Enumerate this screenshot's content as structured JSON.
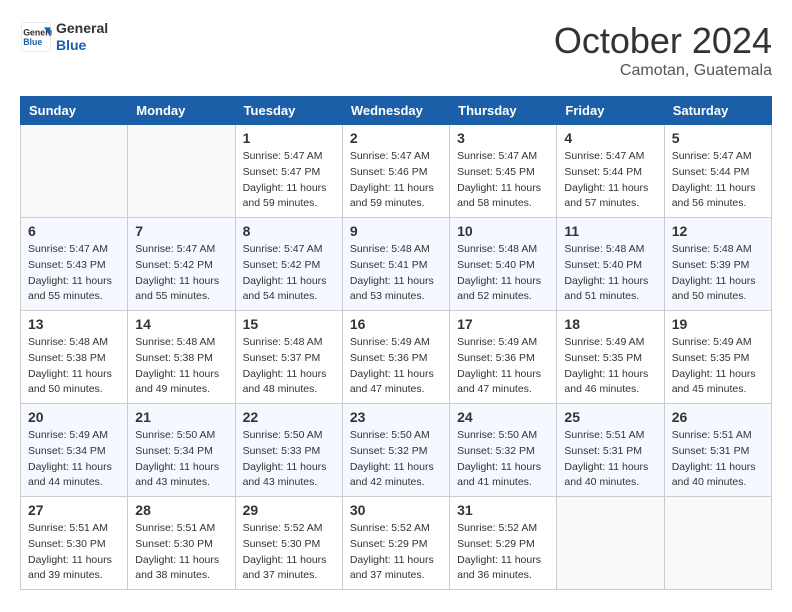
{
  "header": {
    "logo_line1": "General",
    "logo_line2": "Blue",
    "month": "October 2024",
    "location": "Camotan, Guatemala"
  },
  "weekdays": [
    "Sunday",
    "Monday",
    "Tuesday",
    "Wednesday",
    "Thursday",
    "Friday",
    "Saturday"
  ],
  "weeks": [
    [
      {
        "day": "",
        "sunrise": "",
        "sunset": "",
        "daylight": ""
      },
      {
        "day": "",
        "sunrise": "",
        "sunset": "",
        "daylight": ""
      },
      {
        "day": "1",
        "sunrise": "Sunrise: 5:47 AM",
        "sunset": "Sunset: 5:47 PM",
        "daylight": "Daylight: 11 hours and 59 minutes."
      },
      {
        "day": "2",
        "sunrise": "Sunrise: 5:47 AM",
        "sunset": "Sunset: 5:46 PM",
        "daylight": "Daylight: 11 hours and 59 minutes."
      },
      {
        "day": "3",
        "sunrise": "Sunrise: 5:47 AM",
        "sunset": "Sunset: 5:45 PM",
        "daylight": "Daylight: 11 hours and 58 minutes."
      },
      {
        "day": "4",
        "sunrise": "Sunrise: 5:47 AM",
        "sunset": "Sunset: 5:44 PM",
        "daylight": "Daylight: 11 hours and 57 minutes."
      },
      {
        "day": "5",
        "sunrise": "Sunrise: 5:47 AM",
        "sunset": "Sunset: 5:44 PM",
        "daylight": "Daylight: 11 hours and 56 minutes."
      }
    ],
    [
      {
        "day": "6",
        "sunrise": "Sunrise: 5:47 AM",
        "sunset": "Sunset: 5:43 PM",
        "daylight": "Daylight: 11 hours and 55 minutes."
      },
      {
        "day": "7",
        "sunrise": "Sunrise: 5:47 AM",
        "sunset": "Sunset: 5:42 PM",
        "daylight": "Daylight: 11 hours and 55 minutes."
      },
      {
        "day": "8",
        "sunrise": "Sunrise: 5:47 AM",
        "sunset": "Sunset: 5:42 PM",
        "daylight": "Daylight: 11 hours and 54 minutes."
      },
      {
        "day": "9",
        "sunrise": "Sunrise: 5:48 AM",
        "sunset": "Sunset: 5:41 PM",
        "daylight": "Daylight: 11 hours and 53 minutes."
      },
      {
        "day": "10",
        "sunrise": "Sunrise: 5:48 AM",
        "sunset": "Sunset: 5:40 PM",
        "daylight": "Daylight: 11 hours and 52 minutes."
      },
      {
        "day": "11",
        "sunrise": "Sunrise: 5:48 AM",
        "sunset": "Sunset: 5:40 PM",
        "daylight": "Daylight: 11 hours and 51 minutes."
      },
      {
        "day": "12",
        "sunrise": "Sunrise: 5:48 AM",
        "sunset": "Sunset: 5:39 PM",
        "daylight": "Daylight: 11 hours and 50 minutes."
      }
    ],
    [
      {
        "day": "13",
        "sunrise": "Sunrise: 5:48 AM",
        "sunset": "Sunset: 5:38 PM",
        "daylight": "Daylight: 11 hours and 50 minutes."
      },
      {
        "day": "14",
        "sunrise": "Sunrise: 5:48 AM",
        "sunset": "Sunset: 5:38 PM",
        "daylight": "Daylight: 11 hours and 49 minutes."
      },
      {
        "day": "15",
        "sunrise": "Sunrise: 5:48 AM",
        "sunset": "Sunset: 5:37 PM",
        "daylight": "Daylight: 11 hours and 48 minutes."
      },
      {
        "day": "16",
        "sunrise": "Sunrise: 5:49 AM",
        "sunset": "Sunset: 5:36 PM",
        "daylight": "Daylight: 11 hours and 47 minutes."
      },
      {
        "day": "17",
        "sunrise": "Sunrise: 5:49 AM",
        "sunset": "Sunset: 5:36 PM",
        "daylight": "Daylight: 11 hours and 47 minutes."
      },
      {
        "day": "18",
        "sunrise": "Sunrise: 5:49 AM",
        "sunset": "Sunset: 5:35 PM",
        "daylight": "Daylight: 11 hours and 46 minutes."
      },
      {
        "day": "19",
        "sunrise": "Sunrise: 5:49 AM",
        "sunset": "Sunset: 5:35 PM",
        "daylight": "Daylight: 11 hours and 45 minutes."
      }
    ],
    [
      {
        "day": "20",
        "sunrise": "Sunrise: 5:49 AM",
        "sunset": "Sunset: 5:34 PM",
        "daylight": "Daylight: 11 hours and 44 minutes."
      },
      {
        "day": "21",
        "sunrise": "Sunrise: 5:50 AM",
        "sunset": "Sunset: 5:34 PM",
        "daylight": "Daylight: 11 hours and 43 minutes."
      },
      {
        "day": "22",
        "sunrise": "Sunrise: 5:50 AM",
        "sunset": "Sunset: 5:33 PM",
        "daylight": "Daylight: 11 hours and 43 minutes."
      },
      {
        "day": "23",
        "sunrise": "Sunrise: 5:50 AM",
        "sunset": "Sunset: 5:32 PM",
        "daylight": "Daylight: 11 hours and 42 minutes."
      },
      {
        "day": "24",
        "sunrise": "Sunrise: 5:50 AM",
        "sunset": "Sunset: 5:32 PM",
        "daylight": "Daylight: 11 hours and 41 minutes."
      },
      {
        "day": "25",
        "sunrise": "Sunrise: 5:51 AM",
        "sunset": "Sunset: 5:31 PM",
        "daylight": "Daylight: 11 hours and 40 minutes."
      },
      {
        "day": "26",
        "sunrise": "Sunrise: 5:51 AM",
        "sunset": "Sunset: 5:31 PM",
        "daylight": "Daylight: 11 hours and 40 minutes."
      }
    ],
    [
      {
        "day": "27",
        "sunrise": "Sunrise: 5:51 AM",
        "sunset": "Sunset: 5:30 PM",
        "daylight": "Daylight: 11 hours and 39 minutes."
      },
      {
        "day": "28",
        "sunrise": "Sunrise: 5:51 AM",
        "sunset": "Sunset: 5:30 PM",
        "daylight": "Daylight: 11 hours and 38 minutes."
      },
      {
        "day": "29",
        "sunrise": "Sunrise: 5:52 AM",
        "sunset": "Sunset: 5:30 PM",
        "daylight": "Daylight: 11 hours and 37 minutes."
      },
      {
        "day": "30",
        "sunrise": "Sunrise: 5:52 AM",
        "sunset": "Sunset: 5:29 PM",
        "daylight": "Daylight: 11 hours and 37 minutes."
      },
      {
        "day": "31",
        "sunrise": "Sunrise: 5:52 AM",
        "sunset": "Sunset: 5:29 PM",
        "daylight": "Daylight: 11 hours and 36 minutes."
      },
      {
        "day": "",
        "sunrise": "",
        "sunset": "",
        "daylight": ""
      },
      {
        "day": "",
        "sunrise": "",
        "sunset": "",
        "daylight": ""
      }
    ]
  ]
}
